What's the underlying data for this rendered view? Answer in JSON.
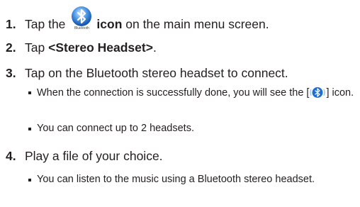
{
  "steps": [
    {
      "number": "1.",
      "text_before": "Tap the",
      "icon": "bluetooth-icon",
      "icon_caption": "Bluetooth",
      "bold_text": "icon",
      "text_after": "on the main menu screen."
    },
    {
      "number": "2.",
      "text_before": "Tap",
      "bold_text": "<Stereo Headset>",
      "text_after": "."
    },
    {
      "number": "3.",
      "text": "Tap on the Bluetooth stereo headset to connect.",
      "notes": [
        {
          "text_before": "When the connection is successfully done, you will see the [",
          "icon": "bluetooth-headset-connected-icon",
          "text_after": "] icon."
        },
        {
          "text": "You can connect up to 2 headsets."
        }
      ]
    },
    {
      "number": "4.",
      "text": "Play a file of your choice.",
      "notes": [
        {
          "text": "You can listen to the music using a Bluetooth stereo headset."
        }
      ]
    }
  ],
  "colors": {
    "text": "#231f20",
    "icon_blue": "#1c6fd1",
    "icon_light_blue": "#9cc6f4"
  }
}
